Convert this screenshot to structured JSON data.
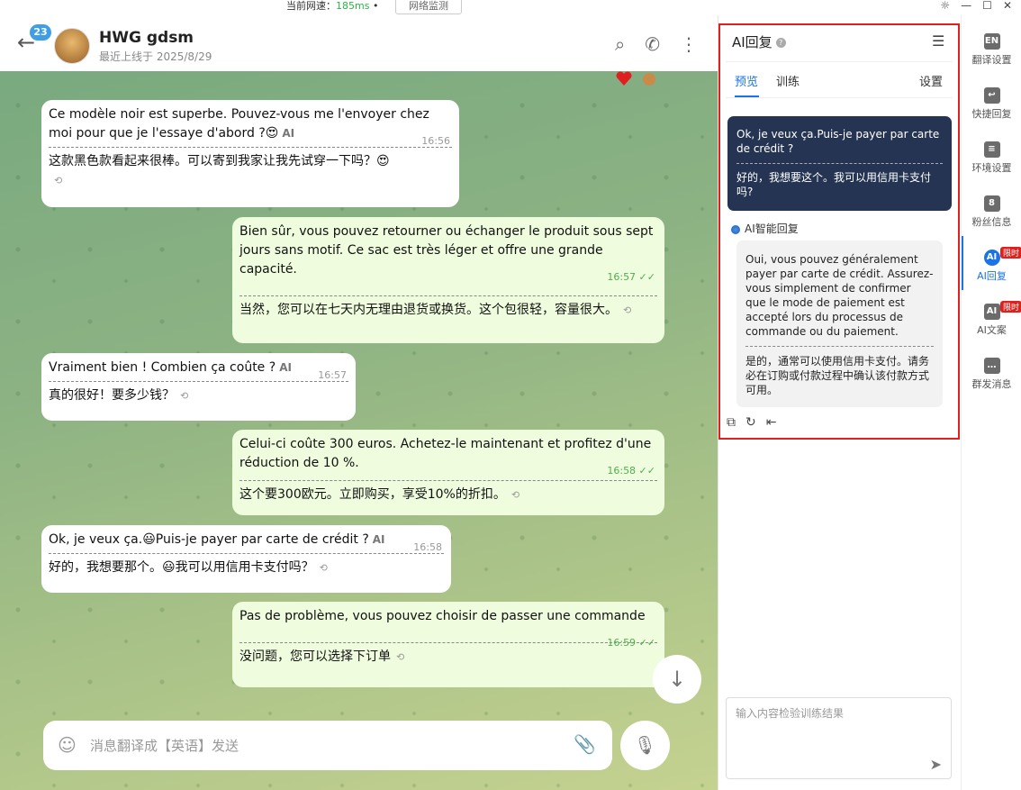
{
  "topbar": {
    "net_label": "当前网速：",
    "net_value": "185ms",
    "net_button": "网络监测"
  },
  "window_icons": [
    "sun-icon",
    "minimize-icon",
    "maximize-icon",
    "close-icon"
  ],
  "header": {
    "unread_badge": "23",
    "name": "HWG gdsm",
    "last_seen": "最近上线于 2025/8/29"
  },
  "messages": [
    {
      "dir": "in",
      "text": "Ce modèle noir est superbe. Pouvez-vous me l'envoyer chez moi pour que je l'essaye d'abord ?😍",
      "ai": "AI",
      "time": "16:56",
      "translation": "这款黑色款看起来很棒。可以寄到我家让我先试穿一下吗？😍"
    },
    {
      "dir": "out",
      "text": "Bien sûr, vous pouvez retourner ou échanger le produit sous sept jours sans motif. Ce sac est très léger et offre une grande capacité.",
      "time": "16:57",
      "translation": "当然，您可以在七天内无理由退货或换货。这个包很轻，容量很大。"
    },
    {
      "dir": "in",
      "text": "Vraiment bien ! Combien ça coûte ?",
      "ai": "AI",
      "time": "16:57",
      "translation": "真的很好！要多少钱？"
    },
    {
      "dir": "out",
      "text": "Celui-ci coûte 300 euros. Achetez-le maintenant et profitez d'une réduction de 10 %.",
      "time": "16:58",
      "translation": "这个要300欧元。立即购买，享受10%的折扣。"
    },
    {
      "dir": "in",
      "text": "Ok, je veux ça.😃Puis-je payer par carte de crédit ?",
      "ai": "AI",
      "time": "16:58",
      "translation": "好的，我想要那个。😃我可以用信用卡支付吗？"
    },
    {
      "dir": "out",
      "text": "Pas de problème, vous pouvez choisir de passer une commande",
      "time": "16:59",
      "translation": "没问题，您可以选择下订单"
    }
  ],
  "composer": {
    "placeholder": "消息翻译成【英语】发送"
  },
  "ai_panel": {
    "title": "AI回复",
    "tabs": [
      "预览",
      "训练"
    ],
    "settings": "设置",
    "question": {
      "text": "Ok, je veux ça.Puis-je payer par carte de crédit ?",
      "translation": "好的，我想要这个。我可以用信用卡支付吗?"
    },
    "smart_label": "AI智能回复",
    "reply": {
      "text": "Oui, vous pouvez généralement payer par carte de crédit. Assurez-vous simplement de confirmer que le mode de paiement est accepté lors du processus de commande ou du paiement.",
      "translation": "是的，通常可以使用信用卡支付。请务必在订购或付款过程中确认该付款方式可用。"
    },
    "train_placeholder": "输入内容检验训练结果"
  },
  "rail": [
    {
      "label": "翻译设置",
      "icon_text": "EN"
    },
    {
      "label": "快捷回复",
      "icon_text": "↩"
    },
    {
      "label": "环境设置",
      "icon_text": "≡"
    },
    {
      "label": "粉丝信息",
      "icon_text": "8"
    },
    {
      "label": "AI回复",
      "icon_text": "AI",
      "badge": "限时",
      "active": true
    },
    {
      "label": "AI文案",
      "icon_text": "AI",
      "badge": "限时"
    },
    {
      "label": "群发消息",
      "icon_text": "…"
    }
  ]
}
